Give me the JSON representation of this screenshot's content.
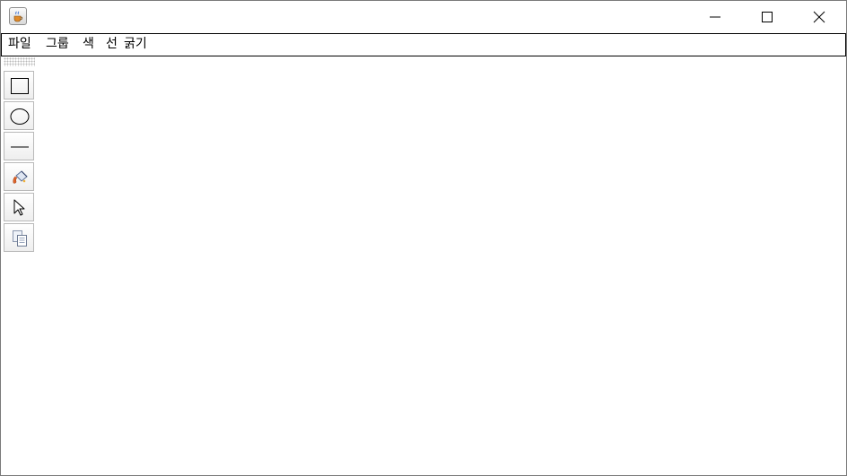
{
  "window": {
    "title": "",
    "app_icon": "java-coffee-cup-icon",
    "controls": [
      "minimize-icon",
      "maximize-icon",
      "close-icon"
    ]
  },
  "menubar": {
    "items": [
      {
        "label": "파일"
      },
      {
        "label": "그룹"
      },
      {
        "label": "색"
      },
      {
        "label": "선"
      },
      {
        "label": "굵기"
      }
    ]
  },
  "toolbar": {
    "tools": [
      {
        "icon": "rectangle-icon"
      },
      {
        "icon": "ellipse-icon"
      },
      {
        "icon": "line-icon"
      },
      {
        "icon": "paint-bucket-icon"
      },
      {
        "icon": "select-arrow-icon"
      },
      {
        "icon": "copy-icon"
      }
    ]
  },
  "colors": {
    "window_background": "#ffffff",
    "menubar_border": "#000000",
    "tool_button_border": "#b9b9b9"
  }
}
